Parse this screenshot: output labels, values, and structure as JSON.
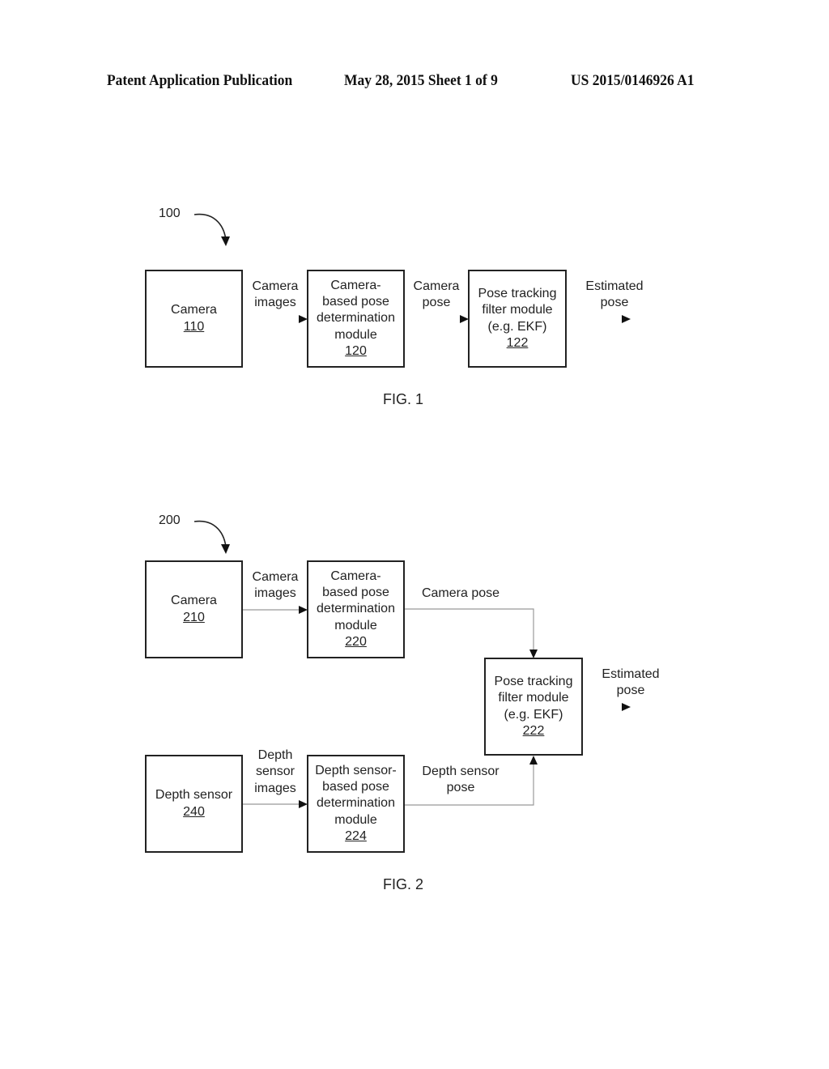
{
  "header": {
    "publication": "Patent Application Publication",
    "date_sheet": "May 28, 2015  Sheet 1 of 9",
    "patent_number": "US 2015/0146926 A1"
  },
  "fig1": {
    "ref": "100",
    "caption": "FIG. 1",
    "boxes": {
      "camera": {
        "lines": [
          "Camera"
        ],
        "ref": "110"
      },
      "pose_determination": {
        "lines": [
          "Camera-",
          "based pose",
          "determination",
          "module"
        ],
        "ref": "120"
      },
      "filter": {
        "lines": [
          "Pose tracking",
          "filter module",
          "(e.g. EKF)"
        ],
        "ref": "122"
      }
    },
    "labels": {
      "camera_images": [
        "Camera",
        "images"
      ],
      "camera_pose": [
        "Camera",
        "pose"
      ],
      "estimated_pose": [
        "Estimated",
        "pose"
      ]
    }
  },
  "fig2": {
    "ref": "200",
    "caption": "FIG. 2",
    "boxes": {
      "camera": {
        "lines": [
          "Camera"
        ],
        "ref": "210"
      },
      "camera_pose_determination": {
        "lines": [
          "Camera-",
          "based pose",
          "determination",
          "module"
        ],
        "ref": "220"
      },
      "filter": {
        "lines": [
          "Pose tracking",
          "filter module",
          "(e.g. EKF)"
        ],
        "ref": "222"
      },
      "depth_sensor": {
        "lines": [
          "Depth sensor"
        ],
        "ref": "240"
      },
      "depth_pose_determination": {
        "lines": [
          "Depth sensor-",
          "based pose",
          "determination",
          "module"
        ],
        "ref": "224"
      }
    },
    "labels": {
      "camera_images": [
        "Camera",
        "images"
      ],
      "camera_pose": [
        "Camera pose"
      ],
      "estimated_pose": [
        "Estimated",
        "pose"
      ],
      "depth_sensor_images": [
        "Depth",
        "sensor",
        "images"
      ],
      "depth_sensor_pose": [
        "Depth sensor",
        "pose"
      ]
    }
  }
}
